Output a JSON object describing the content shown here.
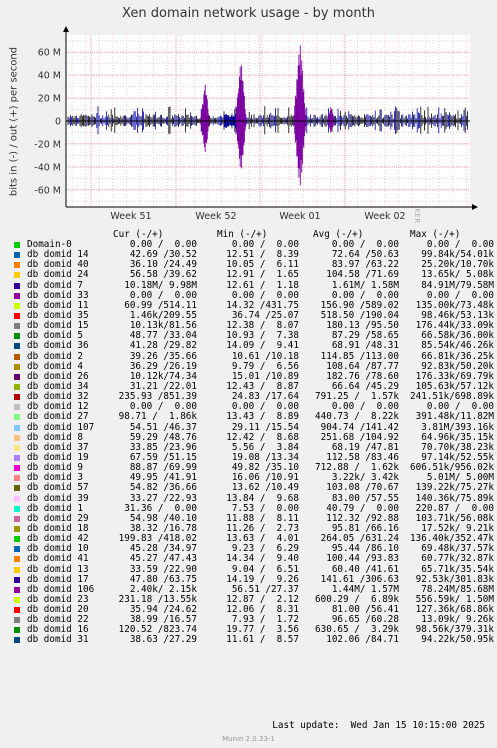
{
  "chart_data": {
    "type": "area",
    "title": "Xen domain network usage - by month",
    "ylabel": "bits in (-) / out (+) per second",
    "watermark": "RRDTOOL / TOBI OETIKER",
    "ylim": [
      -75000000,
      75000000
    ],
    "yticks": [
      {
        "value": 60000000,
        "label": "60 M"
      },
      {
        "value": 40000000,
        "label": "40 M"
      },
      {
        "value": 20000000,
        "label": "20 M"
      },
      {
        "value": 0,
        "label": "0"
      },
      {
        "value": -20000000,
        "label": "-20 M"
      },
      {
        "value": -40000000,
        "label": "-40 M"
      },
      {
        "value": -60000000,
        "label": "-60 M"
      }
    ],
    "xticks": [
      "Week 51",
      "Week 52",
      "Week 01",
      "Week 02"
    ],
    "grid": true,
    "series_colors": {
      "primary": "#7b00a0",
      "secondary": "#0000a0",
      "tertiary": "#000000"
    }
  },
  "legend": {
    "headers": {
      "cur": "Cur (-/+)",
      "min": "Min (-/+)",
      "avg": "Avg (-/+)",
      "max": "Max (-/+)"
    },
    "rows": [
      {
        "name": "Domain-0",
        "color": "#00cc00",
        "cur": "0.00 /  0.00",
        "min": "0.00 /  0.00",
        "avg": "0.00 /  0.00",
        "max": "0.00 /  0.00"
      },
      {
        "name": "db domid 14",
        "color": "#0066b3",
        "cur": "42.69 /30.52",
        "min": "12.51 /  8.39",
        "avg": "72.64 /50.63",
        "max": "99.84k/54.01k"
      },
      {
        "name": "db domid 40",
        "color": "#ff8000",
        "cur": "36.10 /24.49",
        "min": "10.05 /  6.11",
        "avg": "83.97 /63.22",
        "max": "25.20k/10.70k"
      },
      {
        "name": "db domid 24",
        "color": "#ffcc00",
        "cur": "56.58 /39.62",
        "min": "12.91 /  1.65",
        "avg": "104.58 /71.69",
        "max": "13.65k/ 5.08k"
      },
      {
        "name": "db domid 7",
        "color": "#330099",
        "cur": "10.18M/ 9.98M",
        "min": "12.61 /  1.18",
        "avg": "1.61M/ 1.58M",
        "max": "84.91M/79.58M"
      },
      {
        "name": "db domid 33",
        "color": "#990099",
        "cur": "0.00 /  0.00",
        "min": "0.00 /  0.00",
        "avg": "0.00 /  0.00",
        "max": "0.00 /  0.00"
      },
      {
        "name": "db domid 11",
        "color": "#ccff00",
        "cur": "60.99 /514.11",
        "min": "14.32 /431.75",
        "avg": "156.90 /589.02",
        "max": "135.00k/73.48k"
      },
      {
        "name": "db domid 35",
        "color": "#ff0000",
        "cur": "1.46k/209.55",
        "min": "36.74 /25.07",
        "avg": "518.50 /190.04",
        "max": "98.46k/53.13k"
      },
      {
        "name": "db domid 15",
        "color": "#808080",
        "cur": "10.13k/81.56",
        "min": "12.38 /  8.07",
        "avg": "180.13 /95.50",
        "max": "176.44k/33.09k"
      },
      {
        "name": "db domid 5",
        "color": "#008f00",
        "cur": "48.77 /33.04",
        "min": "10.93 /  7.38",
        "avg": "87.29 /58.65",
        "max": "66.58k/36.00k"
      },
      {
        "name": "db domid 36",
        "color": "#00487d",
        "cur": "41.28 /29.82",
        "min": "14.09 /  9.41",
        "avg": "68.91 /48.31",
        "max": "85.54k/46.26k"
      },
      {
        "name": "db domid 2",
        "color": "#b35a00",
        "cur": "39.26 /35.66",
        "min": "10.61 /10.18",
        "avg": "114.85 /113.00",
        "max": "66.81k/36.25k"
      },
      {
        "name": "db domid 4",
        "color": "#b38f00",
        "cur": "36.29 /26.19",
        "min": "9.79 /  6.56",
        "avg": "108.64 /87.77",
        "max": "92.83k/50.20k"
      },
      {
        "name": "db domid 26",
        "color": "#6b006b",
        "cur": "10.12k/74.34",
        "min": "15.01 /10.89",
        "avg": "182.76 /78.60",
        "max": "176.33k/69.79k"
      },
      {
        "name": "db domid 34",
        "color": "#8fb300",
        "cur": "31.21 /22.01",
        "min": "12.43 /  8.87",
        "avg": "66.64 /45.29",
        "max": "105.63k/57.12k"
      },
      {
        "name": "db domid 32",
        "color": "#b30000",
        "cur": "235.93 /851.39",
        "min": "24.83 /17.64",
        "avg": "791.25 /  1.57k",
        "max": "241.51k/698.89k"
      },
      {
        "name": "db domid 12",
        "color": "#bebebe",
        "cur": "0.00 /  0.00",
        "min": "0.00 /  0.00",
        "avg": "0.00 /  0.00",
        "max": "0.00 /  0.00"
      },
      {
        "name": "db domid 27",
        "color": "#80ff80",
        "cur": "98.71 /  1.86k",
        "min": "13.43 /  8.89",
        "avg": "440.73 /  8.22k",
        "max": "391.48k/11.82M"
      },
      {
        "name": "db domid 107",
        "color": "#80c9ff",
        "cur": "54.51 /46.37",
        "min": "29.11 /15.54",
        "avg": "904.74 /141.42",
        "max": "3.81M/393.16k"
      },
      {
        "name": "db domid 8",
        "color": "#ffc080",
        "cur": "59.29 /48.76",
        "min": "12.42 /  8.68",
        "avg": "251.68 /104.92",
        "max": "64.96k/35.15k"
      },
      {
        "name": "db domid 37",
        "color": "#ffe680",
        "cur": "33.85 /23.96",
        "min": "5.56 /  3.84",
        "avg": "68.19 /47.81",
        "max": "70.70k/38.23k"
      },
      {
        "name": "db domid 19",
        "color": "#aa80ff",
        "cur": "67.59 /51.15",
        "min": "19.08 /13.34",
        "avg": "112.58 /83.46",
        "max": "97.14k/52.55k"
      },
      {
        "name": "db domid 9",
        "color": "#ee00cc",
        "cur": "88.87 /69.99",
        "min": "49.82 /35.10",
        "avg": "712.88 /  1.62k",
        "max": "606.51k/956.02k"
      },
      {
        "name": "db domid 3",
        "color": "#ff8080",
        "cur": "49.95 /41.91",
        "min": "16.06 /10.91",
        "avg": "3.22k/ 3.42k",
        "max": "5.01M/ 5.00M"
      },
      {
        "name": "db domid 57",
        "color": "#666600",
        "cur": "54.82 /36.66",
        "min": "13.62 /10.49",
        "avg": "103.08 /70.67",
        "max": "139.22k/75.27k"
      },
      {
        "name": "db domid 39",
        "color": "#ffbfff",
        "cur": "33.27 /22.93",
        "min": "13.84 /  9.68",
        "avg": "83.00 /57.55",
        "max": "140.36k/75.89k"
      },
      {
        "name": "db domid 1",
        "color": "#00ffcc",
        "cur": "31.36 /  0.00",
        "min": "7.53 /  0.00",
        "avg": "40.79 /  0.00",
        "max": "220.87 /  0.00"
      },
      {
        "name": "db domid 29",
        "color": "#cc6699",
        "cur": "54.98 /40.10",
        "min": "11.88 /  8.11",
        "avg": "112.32 /92.88",
        "max": "103.71k/56.08k"
      },
      {
        "name": "db domid 18",
        "color": "#999900",
        "cur": "38.32 /16.78",
        "min": "11.26 /  2.73",
        "avg": "95.81 /66.16",
        "max": "17.52k/ 9.21k"
      },
      {
        "name": "db domid 42",
        "color": "#00cc00",
        "cur": "199.83 /418.02",
        "min": "13.63 /  4.01",
        "avg": "264.05 /631.24",
        "max": "136.40k/352.47k"
      },
      {
        "name": "db domid 10",
        "color": "#0066b3",
        "cur": "45.28 /34.97",
        "min": "9.23 /  6.29",
        "avg": "95.44 /86.10",
        "max": "69.48k/37.57k"
      },
      {
        "name": "db domid 41",
        "color": "#ff8000",
        "cur": "45.27 /47.43",
        "min": "14.34 /  9.40",
        "avg": "100.44 /93.83",
        "max": "60.77k/32.87k"
      },
      {
        "name": "db domid 13",
        "color": "#ffcc00",
        "cur": "33.59 /22.90",
        "min": "9.04 /  6.51",
        "avg": "60.40 /41.61",
        "max": "65.71k/35.54k"
      },
      {
        "name": "db domid 17",
        "color": "#330099",
        "cur": "47.80 /63.75",
        "min": "14.19 /  9.26",
        "avg": "141.61 /306.63",
        "max": "92.53k/301.83k"
      },
      {
        "name": "db domid 106",
        "color": "#990099",
        "cur": "2.40k/ 2.15k",
        "min": "56.51 /27.37",
        "avg": "1.44M/ 1.57M",
        "max": "78.24M/85.68M"
      },
      {
        "name": "db domid 23",
        "color": "#ccff00",
        "cur": "231.18 /13.55k",
        "min": "12.87 /  2.12",
        "avg": "600.29 /  6.89k",
        "max": "556.59k/ 1.50M"
      },
      {
        "name": "db domid 20",
        "color": "#ff0000",
        "cur": "35.94 /24.62",
        "min": "12.06 /  8.31",
        "avg": "81.00 /56.41",
        "max": "127.36k/68.86k"
      },
      {
        "name": "db domid 22",
        "color": "#808080",
        "cur": "38.99 /16.57",
        "min": "7.93 /  1.72",
        "avg": "96.65 /60.28",
        "max": "13.09k/ 9.26k"
      },
      {
        "name": "db domid 16",
        "color": "#008f00",
        "cur": "120.52 /823.74",
        "min": "19.77 /  3.56",
        "avg": "630.65 /  3.29k",
        "max": "98.56k/379.31k"
      },
      {
        "name": "db domid 31",
        "color": "#00487d",
        "cur": "38.63 /27.29",
        "min": "11.61 /  8.57",
        "avg": "102.06 /84.71",
        "max": "94.22k/50.95k"
      }
    ]
  },
  "footer": {
    "last_update": "Last update:  Wed Jan 15 10:15:00 2025",
    "munin": "Munin 2.0.33-1"
  }
}
